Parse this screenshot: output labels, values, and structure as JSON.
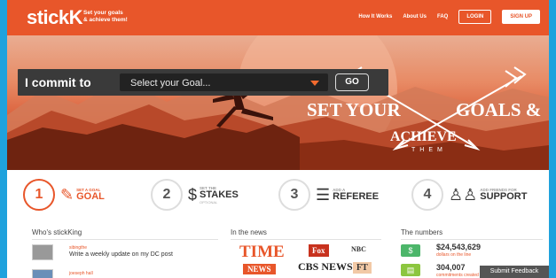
{
  "header": {
    "logo": "stickK",
    "tagline_line1": "Set your goals",
    "tagline_line2": "& achieve them!",
    "nav": [
      "How It Works",
      "About Us",
      "FAQ"
    ],
    "login": "LOGIN",
    "signup": "SIGN UP"
  },
  "commit": {
    "label": "I commit to",
    "select_placeholder": "Select your Goal...",
    "go": "GO"
  },
  "hero": {
    "set_your": "SET YOUR",
    "goals": "GOALS",
    "ampersand": "&",
    "achieve": "ACHIEVE",
    "them": "THEM"
  },
  "steps": [
    {
      "num": "1",
      "small": "SET A GOAL",
      "big": "GOAL",
      "sub": ""
    },
    {
      "num": "2",
      "small": "SET THE",
      "big": "STAKES",
      "sub": "OPTIONAL"
    },
    {
      "num": "3",
      "small": "ADD A",
      "big": "REFEREE",
      "sub": ""
    },
    {
      "num": "4",
      "small": "ADD FRIENDS FOR",
      "big": "SUPPORT",
      "sub": ""
    }
  ],
  "whos_sticking": {
    "title": "Who's stickKing",
    "items": [
      {
        "user": "sibingthe",
        "text": "Write a weekly update on my DC post"
      },
      {
        "user": "joeseph hall",
        "text": ""
      }
    ]
  },
  "news": {
    "title": "In the news",
    "logos": [
      "TIME",
      "Fox",
      "NBC",
      "NEWS",
      "CBS NEWS",
      "FT"
    ]
  },
  "numbers": {
    "title": "The numbers",
    "items": [
      {
        "value": "$24,543,629",
        "label": "dollars on the line"
      },
      {
        "value": "304,007",
        "label": "commitments created"
      }
    ]
  },
  "feedback": "Submit Feedback",
  "colors": {
    "brand": "#e8562a",
    "background": "#1fa2dd",
    "green": "#4cb66a"
  }
}
